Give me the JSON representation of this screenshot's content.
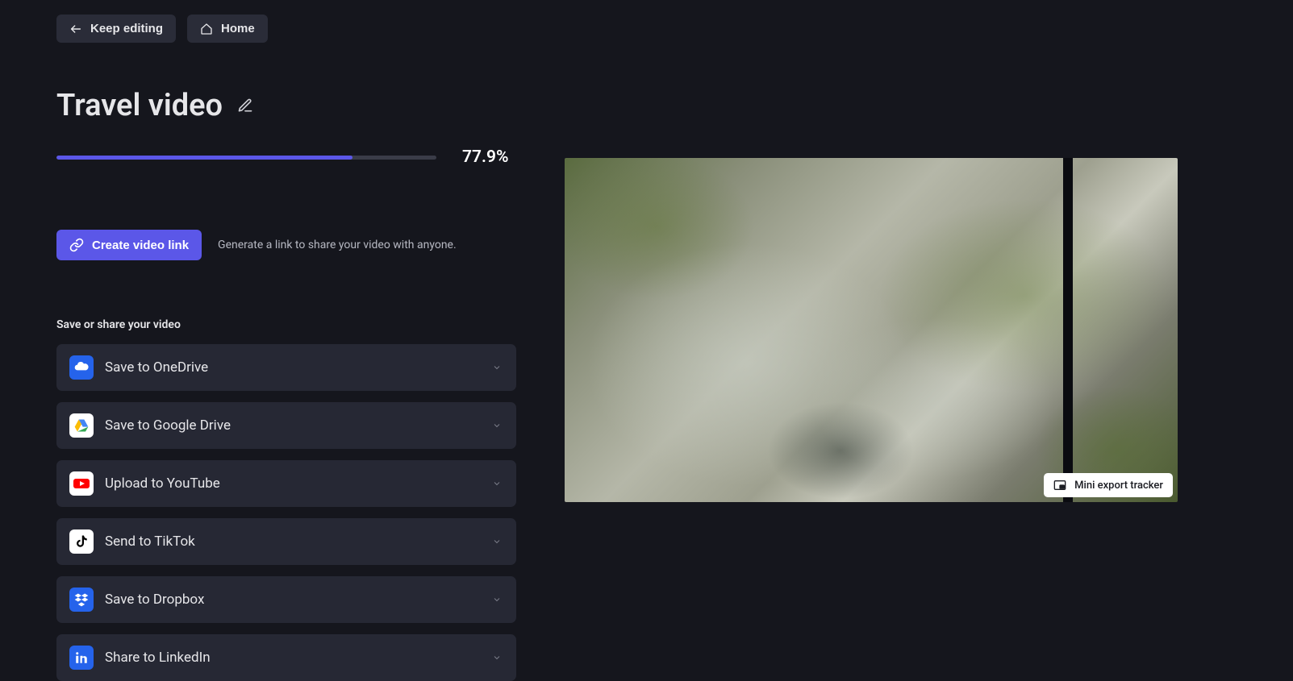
{
  "header": {
    "keep_editing_label": "Keep editing",
    "home_label": "Home"
  },
  "project": {
    "title": "Travel video"
  },
  "export": {
    "progress_value": 77.9,
    "progress_text": "77.9%"
  },
  "link_section": {
    "button_label": "Create video link",
    "description": "Generate a link to share your video with anyone."
  },
  "share": {
    "section_label": "Save or share your video",
    "items": [
      {
        "id": "onedrive",
        "label": "Save to OneDrive",
        "icon": "cloud"
      },
      {
        "id": "gdrive",
        "label": "Save to Google Drive",
        "icon": "gdrive"
      },
      {
        "id": "youtube",
        "label": "Upload to YouTube",
        "icon": "youtube"
      },
      {
        "id": "tiktok",
        "label": "Send to TikTok",
        "icon": "tiktok"
      },
      {
        "id": "dropbox",
        "label": "Save to Dropbox",
        "icon": "dropbox"
      },
      {
        "id": "linkedin",
        "label": "Share to LinkedIn",
        "icon": "linkedin"
      }
    ]
  },
  "tracker": {
    "label": "Mini export tracker"
  },
  "colors": {
    "accent": "#5b57e8",
    "bg": "#15161d",
    "panel": "#262834"
  }
}
